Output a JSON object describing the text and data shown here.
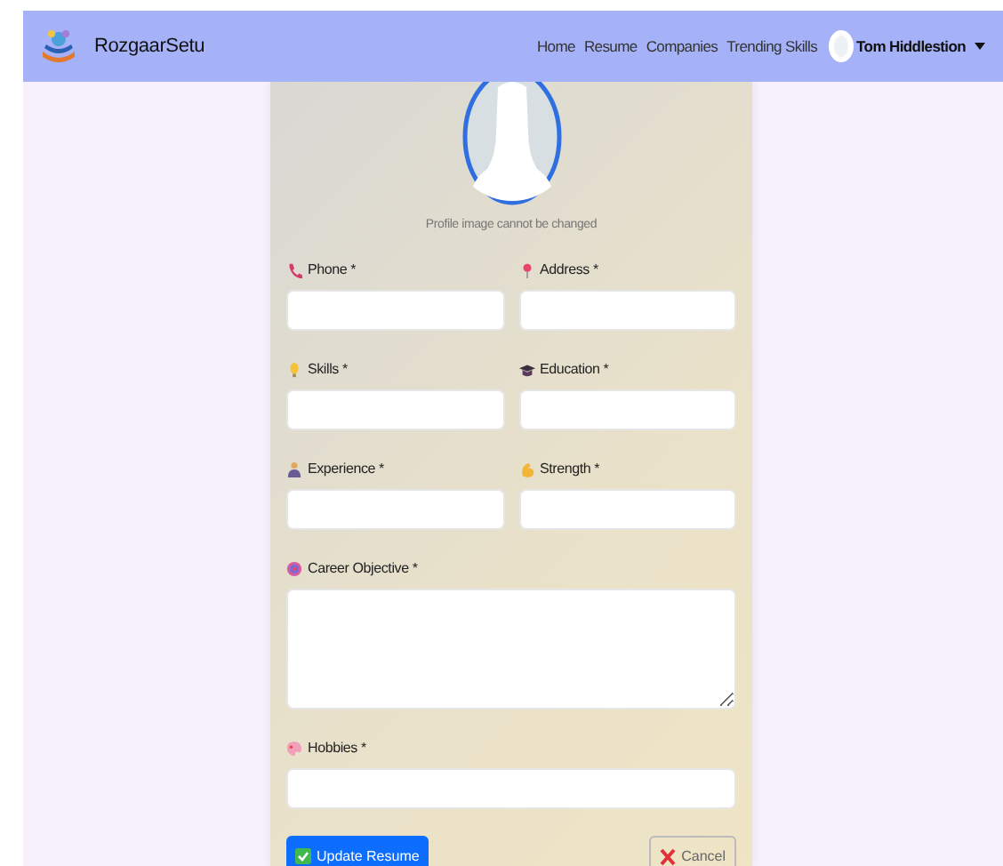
{
  "navbar": {
    "brand": "RozgaarSetu",
    "links": [
      "Home",
      "Resume",
      "Companies",
      "Trending Skills"
    ],
    "user": {
      "name": "Tom Hiddlestion"
    }
  },
  "profile": {
    "note": "Profile image cannot be changed"
  },
  "fields": [
    {
      "label": "Phone *",
      "kind": "half"
    },
    {
      "label": "Address *",
      "kind": "half"
    },
    {
      "label": "Skills *",
      "kind": "half"
    },
    {
      "label": "Education *",
      "kind": "half"
    },
    {
      "label": "Experience *",
      "kind": "half"
    },
    {
      "label": "Strength *",
      "kind": "half"
    },
    {
      "label": "Career Objective *",
      "kind": "textarea"
    },
    {
      "label": "Hobbies *",
      "kind": "full"
    }
  ],
  "buttons": [
    {
      "label": "Update Resume",
      "kind": "primary"
    },
    {
      "label": "Cancel",
      "kind": "cancel"
    }
  ]
}
